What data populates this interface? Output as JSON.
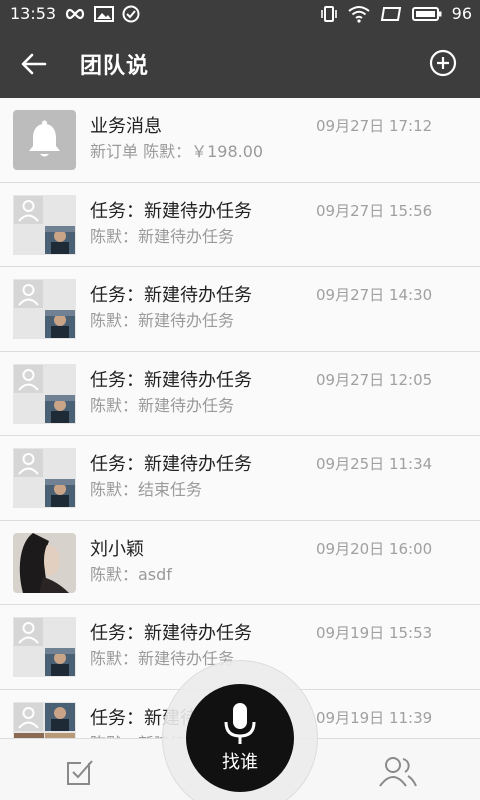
{
  "status_bar": {
    "time": "13:53",
    "battery": "96"
  },
  "header": {
    "title": "团队说"
  },
  "messages": [
    {
      "title": "业务消息",
      "subtitle": "新订单 陈默：￥198.00",
      "time": "09月27日 17:12",
      "avatar": "bell"
    },
    {
      "title": "任务：新建待办任务",
      "subtitle": "陈默：新建待办任务",
      "time": "09月27日 15:56",
      "avatar": "group"
    },
    {
      "title": "任务：新建待办任务",
      "subtitle": "陈默：新建待办任务",
      "time": "09月27日 14:30",
      "avatar": "group"
    },
    {
      "title": "任务：新建待办任务",
      "subtitle": "陈默：新建待办任务",
      "time": "09月27日 12:05",
      "avatar": "group"
    },
    {
      "title": "任务：新建待办任务",
      "subtitle": "陈默：结束任务",
      "time": "09月25日 11:34",
      "avatar": "group"
    },
    {
      "title": "刘小颖",
      "subtitle": "陈默：asdf",
      "time": "09月20日 16:00",
      "avatar": "person"
    },
    {
      "title": "任务：新建待办任务",
      "subtitle": "陈默：新建待办任务",
      "time": "09月19日 15:53",
      "avatar": "group"
    },
    {
      "title": "任务：新建待办任务",
      "subtitle": "陈默：新建待办任务",
      "time": "09月19日 11:39",
      "avatar": "group"
    }
  ],
  "voice_button": {
    "label": "找谁"
  },
  "colors": {
    "header_bg": "#3d3d3d",
    "voice_bg": "#111111",
    "time_text": "#a0a0a0"
  }
}
